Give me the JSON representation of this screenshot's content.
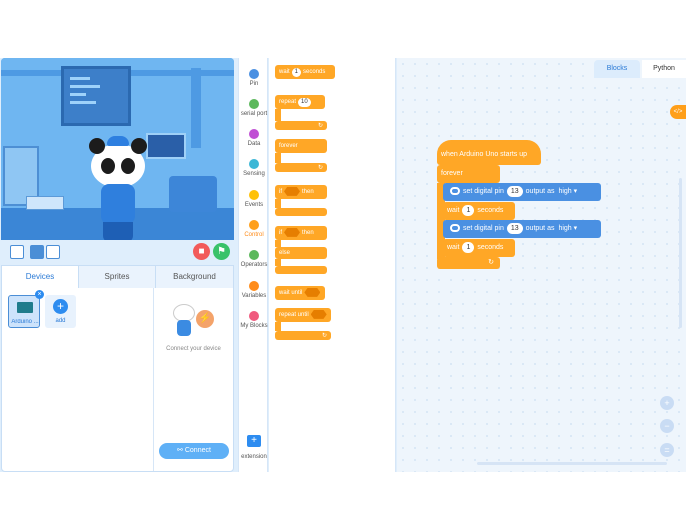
{
  "stage_toolbar": {
    "stop_icon": "stop-icon",
    "run_icon": "flag-icon"
  },
  "device_panel": {
    "tabs": [
      "Devices",
      "Sprites",
      "Background"
    ],
    "device_name": "Arduino ...",
    "add_label": "add",
    "connect_text": "Connect your device",
    "connect_button": "Connect"
  },
  "categories": [
    {
      "label": "Pin",
      "color": "#4a90e2"
    },
    {
      "label": "serial port",
      "color": "#5cb85c"
    },
    {
      "label": "Data",
      "color": "#c04fd4"
    },
    {
      "label": "Sensing",
      "color": "#3cb7d6"
    },
    {
      "label": "Events",
      "color": "#ffc107"
    },
    {
      "label": "Control",
      "color": "#ff9f1a"
    },
    {
      "label": "Operators",
      "color": "#5cb85c"
    },
    {
      "label": "Variables",
      "color": "#ff8c1a"
    },
    {
      "label": "My Blocks",
      "color": "#f05a7e"
    }
  ],
  "extension_label": "extension",
  "palette": {
    "wait": "wait",
    "wait_value": "1",
    "seconds": "seconds",
    "repeat": "repeat",
    "repeat_value": "10",
    "forever": "forever",
    "if": "if",
    "then": "then",
    "else": "else",
    "wait_until": "wait until",
    "repeat_until": "repeat until"
  },
  "workspace": {
    "tab_blocks": "Blocks",
    "tab_python": "Python",
    "code_toggle": "</>",
    "hat": "when Arduino Uno starts up",
    "forever": "forever",
    "set_pin_1": "set digital pin",
    "pin_1": "13",
    "output_as_1": "output as",
    "level_1": "high",
    "wait_1": "wait",
    "wait_1_value": "1",
    "seconds_1": "seconds",
    "set_pin_2": "set digital pin",
    "pin_2": "13",
    "output_as_2": "output as",
    "level_2": "high",
    "wait_2": "wait",
    "wait_2_value": "1",
    "seconds_2": "seconds"
  }
}
